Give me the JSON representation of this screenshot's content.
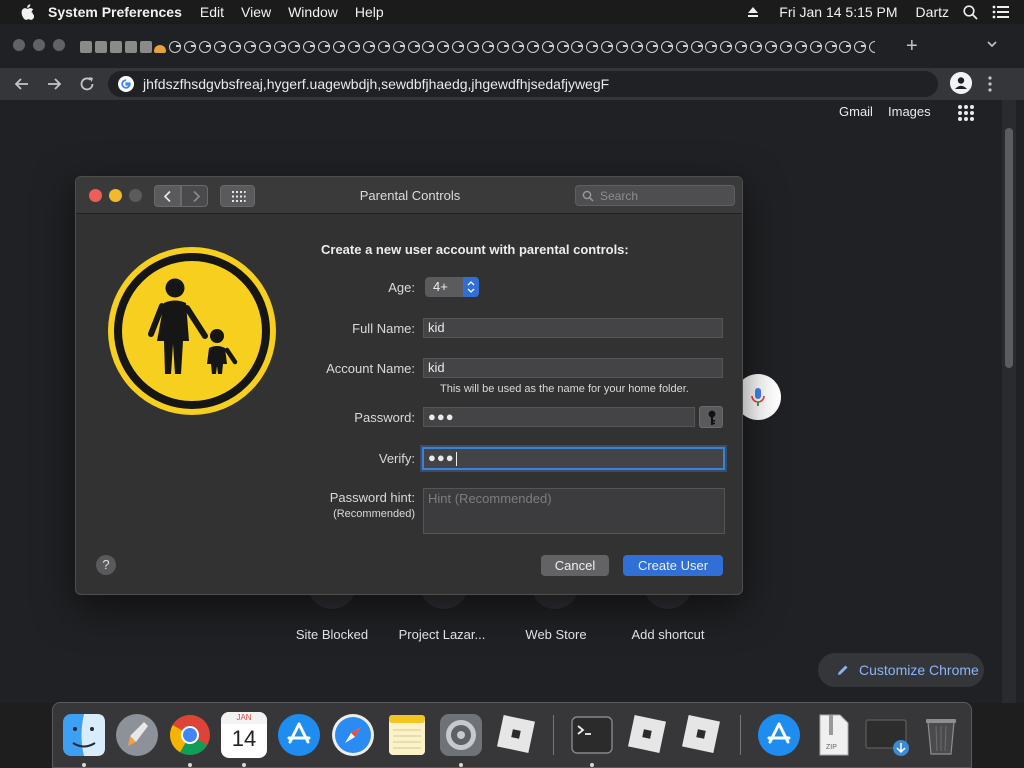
{
  "menubar": {
    "app_name": "System Preferences",
    "menus": [
      "Edit",
      "View",
      "Window",
      "Help"
    ],
    "datetime": "Fri Jan 14  5:15 PM",
    "user": "Dartz"
  },
  "browser": {
    "address": "jhfdszfhsdgvbsfreaj,hygerf.uagewbdjh,sewdbfjhaedg,jhgewdfhjsedafjywegF",
    "links": {
      "gmail": "Gmail",
      "images": "Images"
    },
    "shortcuts": [
      "Site Blocked",
      "Project Lazar...",
      "Web Store",
      "Add shortcut"
    ],
    "customize_label": "Customize Chrome"
  },
  "dialog": {
    "title": "Parental Controls",
    "search_placeholder": "Search",
    "heading": "Create a new user account with parental controls:",
    "age_label": "Age:",
    "age_value": "4+",
    "fullname_label": "Full Name:",
    "fullname_value": "kid",
    "account_label": "Account Name:",
    "account_value": "kid",
    "account_note": "This will be used as the name for your home folder.",
    "password_label": "Password:",
    "password_value": "●●●",
    "verify_label": "Verify:",
    "verify_value": "●●●",
    "hint_label": "Password hint:",
    "hint_sublabel": "(Recommended)",
    "hint_placeholder": "Hint (Recommended)",
    "help_label": "?",
    "cancel_label": "Cancel",
    "create_label": "Create User"
  },
  "dock": {
    "calendar_month": "JAN",
    "calendar_day": "14",
    "zip_label": "ZIP"
  },
  "colors": {
    "accent_blue": "#2f6fd6",
    "parental_yellow": "#f6cf1f",
    "close_red": "#ec5f57",
    "minimize_yellow": "#f2b92d"
  }
}
